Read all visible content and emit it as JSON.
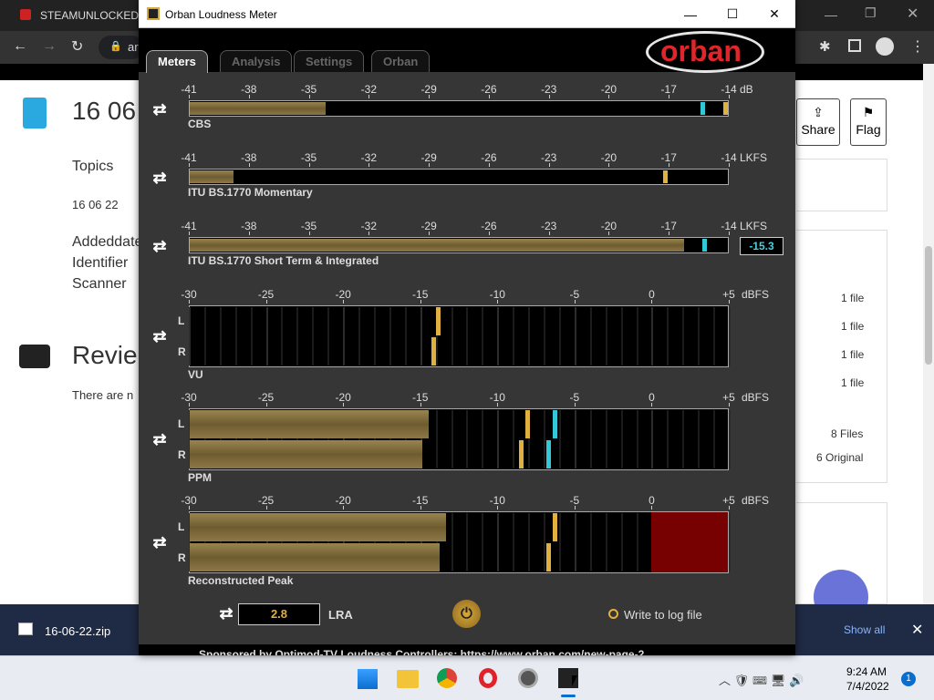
{
  "browser": {
    "tab_title": "STEAMUNLOCKED »",
    "address_partial": "ar",
    "page": {
      "title_partial": "16 06",
      "topics_label": "Topics",
      "topics_value": "16 06 22",
      "meta": [
        "Addeddate",
        "Identifier",
        "Scanner"
      ],
      "reviews_title": "Revie",
      "reviews_text": "There are n",
      "share_label": "Share",
      "flag_label": "Flag",
      "file_rows": [
        "1 file",
        "1 file",
        "1 file",
        "1 file"
      ],
      "files_total": "8 Files",
      "original": "6 Original"
    }
  },
  "downloads": {
    "file": "16-06-22.zip",
    "show_all": "Show all"
  },
  "taskbar": {
    "time": "9:24 AM",
    "date": "7/4/2022",
    "badge": "1"
  },
  "app": {
    "window_title": "Orban Loudness Meter",
    "tabs": [
      "Meters",
      "Analysis",
      "Settings",
      "Orban"
    ],
    "logo": "orban",
    "loud_scale": [
      "-41",
      "-38",
      "-35",
      "-32",
      "-29",
      "-26",
      "-23",
      "-20",
      "-17",
      "-14"
    ],
    "dbfs_scale": [
      "-30",
      "-25",
      "-20",
      "-15",
      "-10",
      "-5",
      "0",
      "+5"
    ],
    "unit_db": "dB",
    "unit_lkfs": "LKFS",
    "unit_dbfs": "dBFS",
    "meters": {
      "cbs": {
        "label": "CBS",
        "level": -34.2,
        "peak": -14.0,
        "marker": -15.4
      },
      "momentary": {
        "label": "ITU BS.1770 Momentary",
        "level": -38.8,
        "peak": -17.3
      },
      "short_term": {
        "label": "ITU BS.1770 Short Term & Integrated",
        "level": -16.3,
        "marker": -15.3,
        "value": "-15.3"
      },
      "vu": {
        "label": "VU",
        "L_peak": -14.0,
        "R_peak": -14.3
      },
      "ppm": {
        "label": "PPM",
        "L_level": -14.5,
        "R_level": -14.9,
        "L_peak": -8.2,
        "R_peak": -8.6,
        "L_cyan": -6.4,
        "R_cyan": -6.8
      },
      "recon": {
        "label": "Reconstructed Peak",
        "L_level": -13.4,
        "R_level": -13.8,
        "L_peak": -6.4,
        "R_peak": -6.8,
        "over_start": 0
      }
    },
    "channel_L": "L",
    "channel_R": "R",
    "lra_value": "2.8",
    "lra_label": "LRA",
    "log_label": "Write to log file",
    "sponsor": "Sponsored by Optimod-TV Loudness Controllers: https://www.orban.com/new-page-2"
  }
}
